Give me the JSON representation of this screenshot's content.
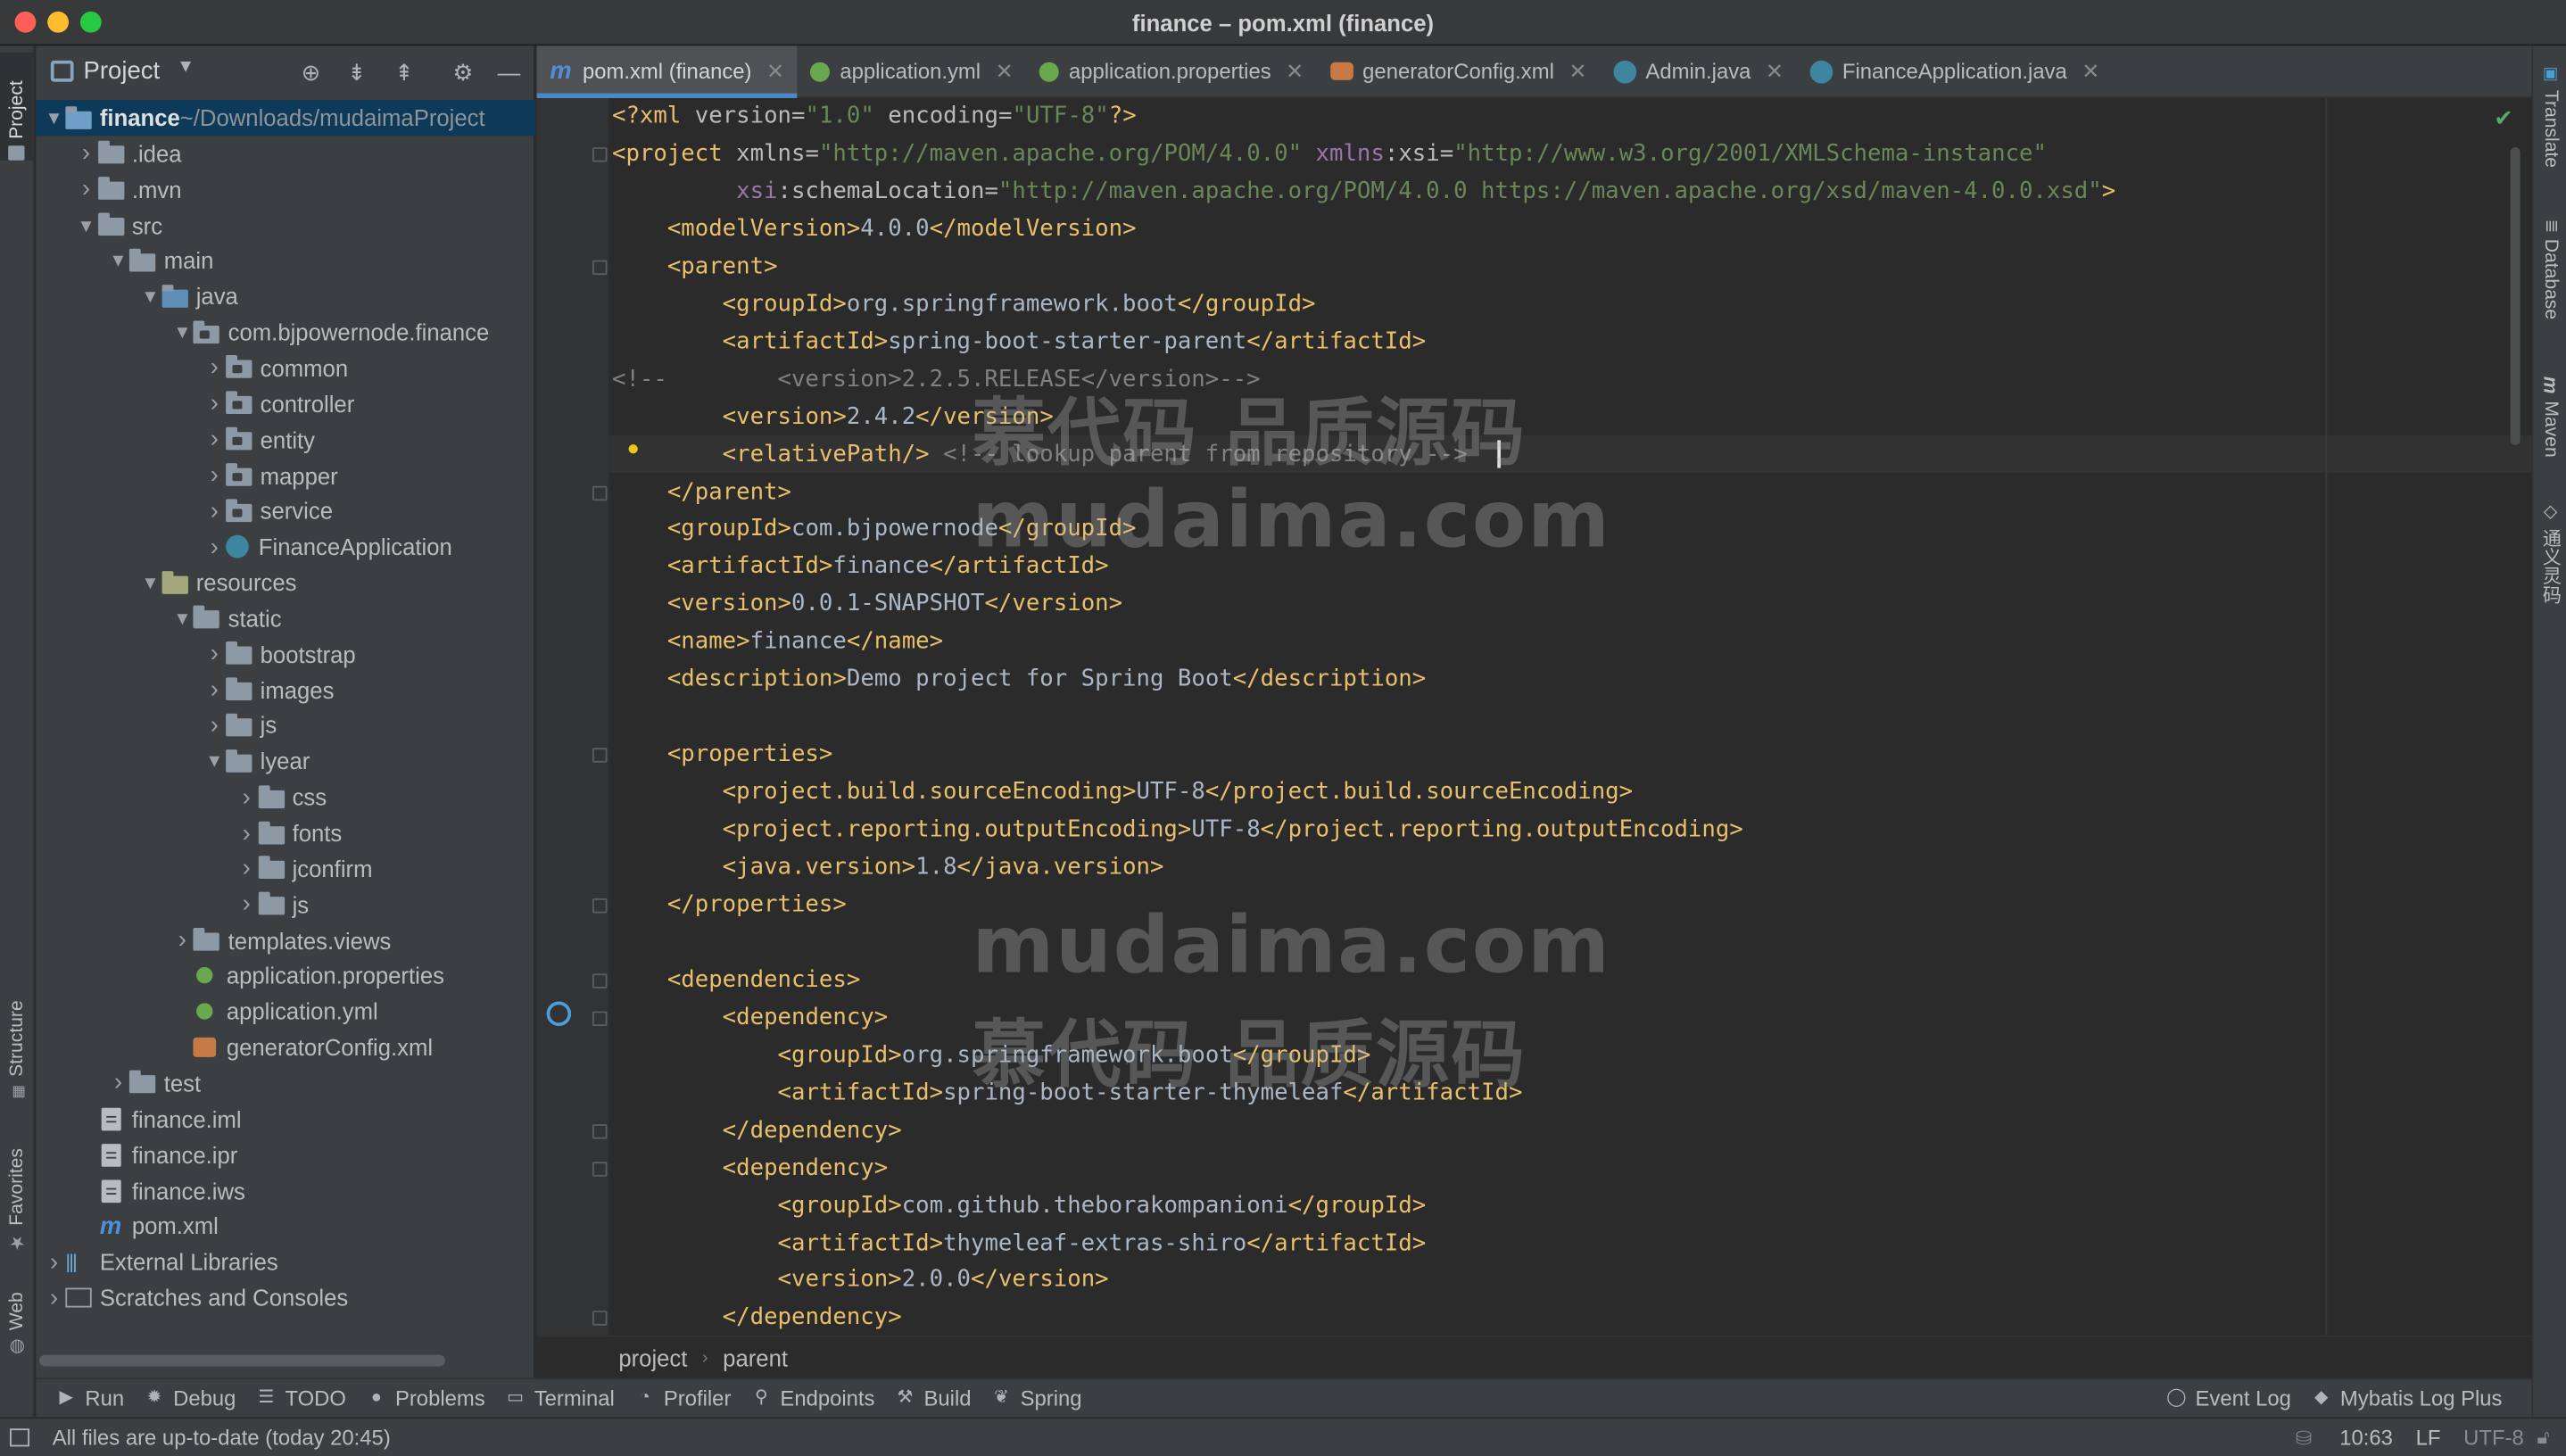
{
  "window": {
    "title": "finance – pom.xml (finance)"
  },
  "left_stripe": {
    "project": "Project",
    "structure": "Structure",
    "favorites": "Favorites",
    "web": "Web"
  },
  "right_stripe": {
    "translate": "Translate",
    "database": "Database",
    "maven": "Maven",
    "tongyi": "通义灵码"
  },
  "project_panel": {
    "title": "Project",
    "tree": [
      {
        "label": "finance",
        "suffix": " ~/Downloads/mudaimaProject",
        "depth": 0,
        "arrow": "down",
        "icon": "module-folder",
        "bold": true,
        "selected": true
      },
      {
        "label": ".idea",
        "depth": 1,
        "arrow": "right",
        "icon": "folder"
      },
      {
        "label": ".mvn",
        "depth": 1,
        "arrow": "right",
        "icon": "folder"
      },
      {
        "label": "src",
        "depth": 1,
        "arrow": "down",
        "icon": "folder"
      },
      {
        "label": "main",
        "depth": 2,
        "arrow": "down",
        "icon": "folder"
      },
      {
        "label": "java",
        "depth": 3,
        "arrow": "down",
        "icon": "source-folder"
      },
      {
        "label": "com.bjpowernode.finance",
        "depth": 4,
        "arrow": "down",
        "icon": "package"
      },
      {
        "label": "common",
        "depth": 5,
        "arrow": "right",
        "icon": "package"
      },
      {
        "label": "controller",
        "depth": 5,
        "arrow": "right",
        "icon": "package"
      },
      {
        "label": "entity",
        "depth": 5,
        "arrow": "right",
        "icon": "package"
      },
      {
        "label": "mapper",
        "depth": 5,
        "arrow": "right",
        "icon": "package"
      },
      {
        "label": "service",
        "depth": 5,
        "arrow": "right",
        "icon": "package"
      },
      {
        "label": "FinanceApplication",
        "depth": 5,
        "arrow": "right",
        "icon": "spring-class"
      },
      {
        "label": "resources",
        "depth": 3,
        "arrow": "down",
        "icon": "resources-folder"
      },
      {
        "label": "static",
        "depth": 4,
        "arrow": "down",
        "icon": "folder"
      },
      {
        "label": "bootstrap",
        "depth": 5,
        "arrow": "right",
        "icon": "folder"
      },
      {
        "label": "images",
        "depth": 5,
        "arrow": "right",
        "icon": "folder"
      },
      {
        "label": "js",
        "depth": 5,
        "arrow": "right",
        "icon": "folder"
      },
      {
        "label": "lyear",
        "depth": 5,
        "arrow": "down",
        "icon": "folder"
      },
      {
        "label": "css",
        "depth": 6,
        "arrow": "right",
        "icon": "folder"
      },
      {
        "label": "fonts",
        "depth": 6,
        "arrow": "right",
        "icon": "folder"
      },
      {
        "label": "jconfirm",
        "depth": 6,
        "arrow": "right",
        "icon": "folder"
      },
      {
        "label": "js",
        "depth": 6,
        "arrow": "right",
        "icon": "folder"
      },
      {
        "label": "templates.views",
        "depth": 4,
        "arrow": "right",
        "icon": "folder"
      },
      {
        "label": "application.properties",
        "depth": 4,
        "arrow": "",
        "icon": "spring-config"
      },
      {
        "label": "application.yml",
        "depth": 4,
        "arrow": "",
        "icon": "spring-config"
      },
      {
        "label": "generatorConfig.xml",
        "depth": 4,
        "arrow": "",
        "icon": "xml"
      },
      {
        "label": "test",
        "depth": 2,
        "arrow": "right",
        "icon": "folder"
      },
      {
        "label": "finance.iml",
        "depth": 1,
        "arrow": "",
        "icon": "file"
      },
      {
        "label": "finance.ipr",
        "depth": 1,
        "arrow": "",
        "icon": "file"
      },
      {
        "label": "finance.iws",
        "depth": 1,
        "arrow": "",
        "icon": "file"
      },
      {
        "label": "pom.xml",
        "depth": 1,
        "arrow": "",
        "icon": "maven"
      },
      {
        "label": "External Libraries",
        "depth": 0,
        "arrow": "right",
        "icon": "libraries"
      },
      {
        "label": "Scratches and Consoles",
        "depth": 0,
        "arrow": "right",
        "icon": "scratches"
      }
    ]
  },
  "tabs": [
    {
      "label": "pom.xml (finance)",
      "icon": "maven",
      "active": true
    },
    {
      "label": "application.yml",
      "icon": "spring-config"
    },
    {
      "label": "application.properties",
      "icon": "spring-config"
    },
    {
      "label": "generatorConfig.xml",
      "icon": "xml"
    },
    {
      "label": "Admin.java",
      "icon": "class"
    },
    {
      "label": "FinanceApplication.java",
      "icon": "spring-class"
    }
  ],
  "code_lines": [
    "<?xml version=\"1.0\" encoding=\"UTF-8\"?>",
    "<project xmlns=\"http://maven.apache.org/POM/4.0.0\" xmlns:xsi=\"http://www.w3.org/2001/XMLSchema-instance\"",
    "         xsi:schemaLocation=\"http://maven.apache.org/POM/4.0.0 https://maven.apache.org/xsd/maven-4.0.0.xsd\">",
    "    <modelVersion>4.0.0</modelVersion>",
    "    <parent>",
    "        <groupId>org.springframework.boot</groupId>",
    "        <artifactId>spring-boot-starter-parent</artifactId>",
    "<!--        <version>2.2.5.RELEASE</version>-->",
    "        <version>2.4.2</version>",
    "        <relativePath/> <!-- lookup parent from repository -->",
    "    </parent>",
    "    <groupId>com.bjpowernode</groupId>",
    "    <artifactId>finance</artifactId>",
    "    <version>0.0.1-SNAPSHOT</version>",
    "    <name>finance</name>",
    "    <description>Demo project for Spring Boot</description>",
    "",
    "    <properties>",
    "        <project.build.sourceEncoding>UTF-8</project.build.sourceEncoding>",
    "        <project.reporting.outputEncoding>UTF-8</project.reporting.outputEncoding>",
    "        <java.version>1.8</java.version>",
    "    </properties>",
    "",
    "    <dependencies>",
    "        <dependency>",
    "            <groupId>org.springframework.boot</groupId>",
    "            <artifactId>spring-boot-starter-thymeleaf</artifactId>",
    "        </dependency>",
    "        <dependency>",
    "            <groupId>com.github.theborakompanioni</groupId>",
    "            <artifactId>thymeleaf-extras-shiro</artifactId>",
    "            <version>2.0.0</version>",
    "        </dependency>"
  ],
  "watermark": {
    "line1": "慕代码 品质源码",
    "line2": "mudaima.com",
    "line3": "mudaima.com",
    "line4": "慕代码 品质源码"
  },
  "breadcrumb": [
    "project",
    "parent"
  ],
  "bottom_tools": [
    {
      "label": "Run",
      "icon": "run-icon"
    },
    {
      "label": "Debug",
      "icon": "bug-icon"
    },
    {
      "label": "TODO",
      "icon": "list-icon"
    },
    {
      "label": "Problems",
      "icon": "info-icon"
    },
    {
      "label": "Terminal",
      "icon": "terminal-icon"
    },
    {
      "label": "Profiler",
      "icon": "profiler-icon"
    },
    {
      "label": "Endpoints",
      "icon": "endpoints-icon"
    },
    {
      "label": "Build",
      "icon": "hammer-icon"
    },
    {
      "label": "Spring",
      "icon": "spring-icon"
    }
  ],
  "bottom_tools_right": [
    {
      "label": "Event Log",
      "icon": "event-log-icon"
    },
    {
      "label": "Mybatis Log Plus",
      "icon": "mybatis-icon"
    }
  ],
  "status": {
    "message": "All files are up-to-date (today 20:45)",
    "position": "10:63",
    "line_sep": "LF",
    "encoding": "UTF-8"
  },
  "colors": {
    "accent": "#4a88c7",
    "selection": "#0d3a58",
    "tag": "#e8bf6a",
    "string": "#6a8759",
    "comment": "#808080"
  }
}
